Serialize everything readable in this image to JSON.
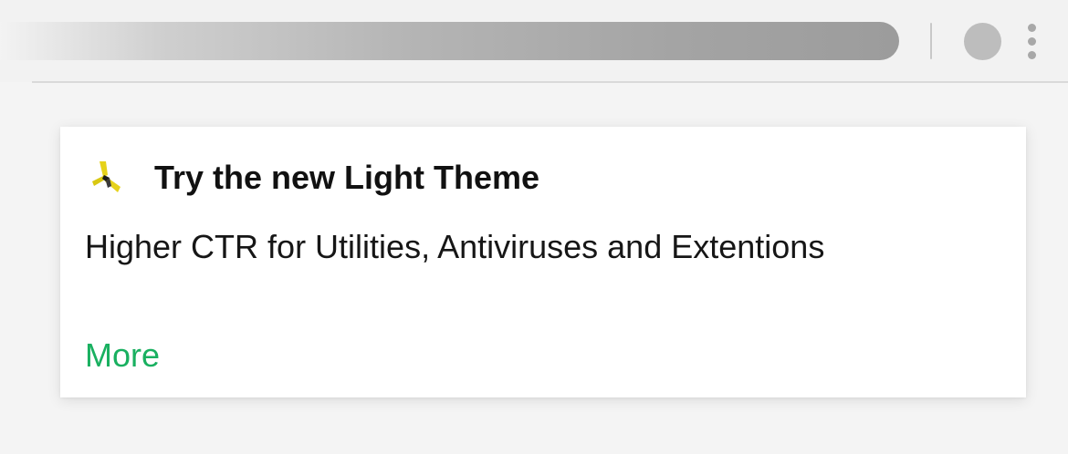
{
  "browser": {
    "icons": [
      "profile-avatar",
      "menu-dots-icon"
    ]
  },
  "notification": {
    "logo_icon": "brand-logo-icon",
    "title": "Try the new Light Theme",
    "body": "Higher CTR for Utilities, Antiviruses and Extentions",
    "link_label": "More",
    "link_color": "#19b060"
  }
}
